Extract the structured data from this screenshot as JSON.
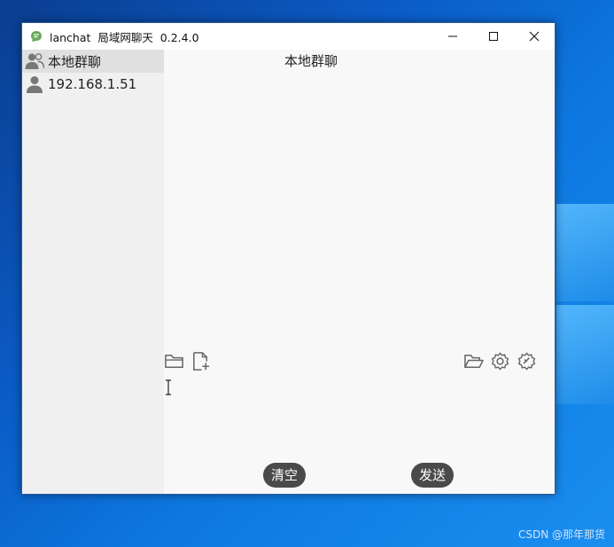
{
  "window": {
    "title": "lanchat  局域网聊天  0.2.4.0"
  },
  "sidebar": {
    "items": [
      {
        "label": "本地群聊",
        "icon": "group-icon",
        "active": true
      },
      {
        "label": "192.168.1.51",
        "icon": "user-icon",
        "active": false
      }
    ]
  },
  "chat": {
    "title": "本地群聊"
  },
  "toolbar": {
    "left_icons": [
      "folder-icon",
      "add-file-icon"
    ],
    "right_icons": [
      "folder-open-icon",
      "settings-icon",
      "settings-badge-icon"
    ]
  },
  "buttons": {
    "clear_label": "清空",
    "send_label": "发送"
  },
  "watermark": "CSDN @那年那货",
  "colors": {
    "app_icon": "#6aaa5a",
    "button_bg": "#4a4a4a",
    "sidebar_active": "#e0e0e0"
  }
}
